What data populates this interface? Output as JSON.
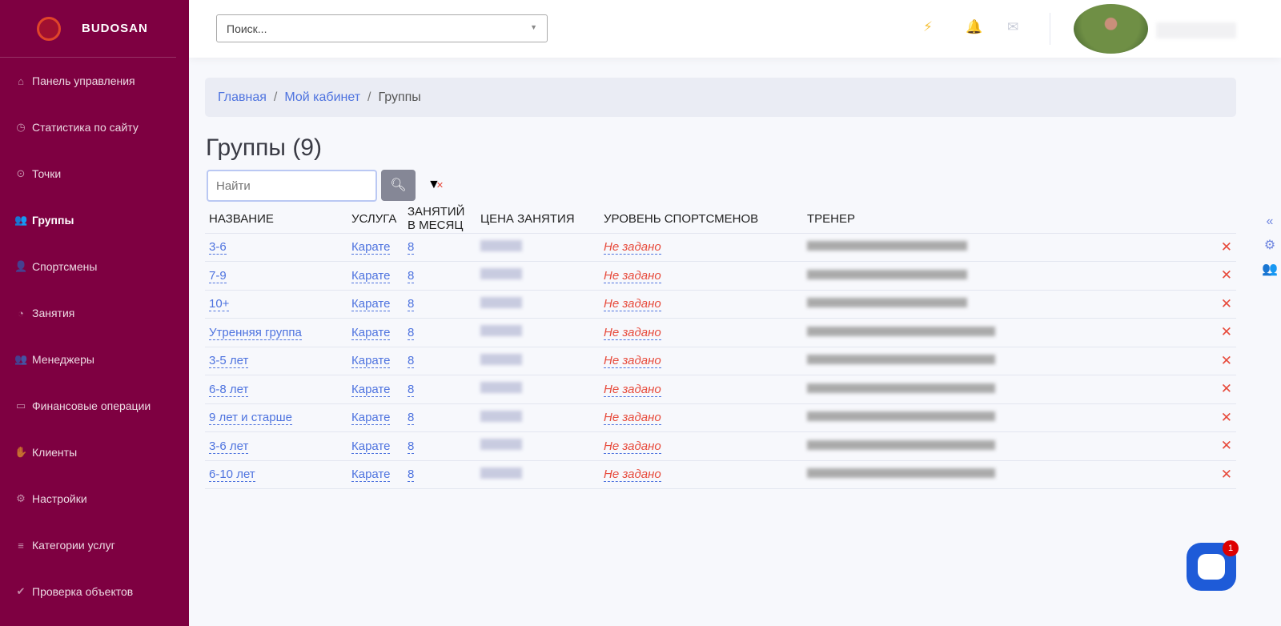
{
  "brand": "BUDOSAN",
  "sidebar": {
    "items": [
      {
        "label": "Панель управления",
        "icon": "⌂"
      },
      {
        "label": "Статистика по сайту",
        "icon": "◷"
      },
      {
        "label": "Точки",
        "icon": "⊙"
      },
      {
        "label": "Группы",
        "icon": "👥"
      },
      {
        "label": "Спортсмены",
        "icon": "👤"
      },
      {
        "label": "Занятия",
        "icon": "◔"
      },
      {
        "label": "Менеджеры",
        "icon": "👥"
      },
      {
        "label": "Финансовые операции",
        "icon": "▭"
      },
      {
        "label": "Клиенты",
        "icon": "✋"
      },
      {
        "label": "Настройки",
        "icon": "⚙"
      },
      {
        "label": "Категории услуг",
        "icon": "≡"
      },
      {
        "label": "Проверка объектов",
        "icon": "✔"
      }
    ]
  },
  "topbar": {
    "search_placeholder": "Поиск..."
  },
  "breadcrumb": {
    "home": "Главная",
    "cabinet": "Мой кабинет",
    "current": "Группы"
  },
  "page": {
    "title": "Группы",
    "count": "(9)",
    "find_placeholder": "Найти"
  },
  "table": {
    "headers": [
      "НАЗВАНИЕ",
      "УСЛУГА",
      "ЗАНЯТИЙ В МЕСЯЦ",
      "ЦЕНА ЗАНЯТИЯ",
      "УРОВЕНЬ СПОРТСМЕНОВ",
      "ТРЕНЕР"
    ],
    "rows": [
      {
        "name": "3-6",
        "service": "Карате",
        "lessons": "8",
        "level": "Не задано"
      },
      {
        "name": "7-9",
        "service": "Карате",
        "lessons": "8",
        "level": "Не задано"
      },
      {
        "name": "10+",
        "service": "Карате",
        "lessons": "8",
        "level": "Не задано"
      },
      {
        "name": "Утренняя группа",
        "service": "Карате",
        "lessons": "8",
        "level": "Не задано"
      },
      {
        "name": "3-5 лет",
        "service": "Карате",
        "lessons": "8",
        "level": "Не задано"
      },
      {
        "name": "6-8 лет",
        "service": "Карате",
        "lessons": "8",
        "level": "Не задано"
      },
      {
        "name": "9 лет и старше",
        "service": "Карате",
        "lessons": "8",
        "level": "Не задано"
      },
      {
        "name": "3-6 лет",
        "service": "Карате",
        "lessons": "8",
        "level": "Не задано"
      },
      {
        "name": "6-10 лет",
        "service": "Карате",
        "lessons": "8",
        "level": "Не задано"
      }
    ]
  },
  "chat": {
    "badge": "1"
  },
  "colors": {
    "sidebar": "#7e0041",
    "link": "#4e73df",
    "danger": "#e74a3b"
  }
}
